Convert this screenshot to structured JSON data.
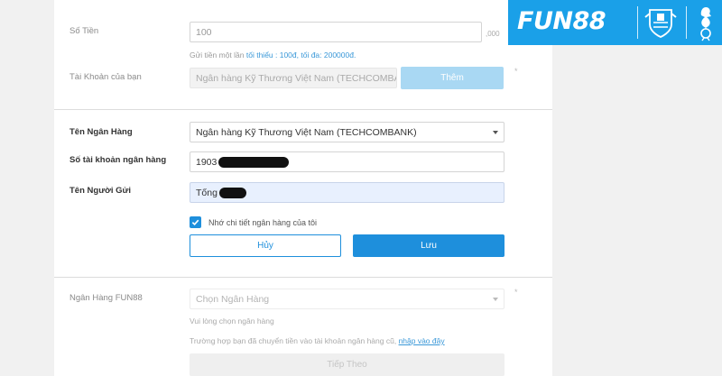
{
  "amount": {
    "label": "Số Tiền",
    "value": "100",
    "suffix": ",000",
    "hint_prefix": "Gửi tiền một lần",
    "hint_link": "tối thiểu : 100đ, tối đa: 200000đ."
  },
  "account": {
    "label": "Tài Khoản của bạn",
    "value": "Ngân hàng Kỹ Thương Việt Nam (TECHCOMBA",
    "add_label": "Thêm",
    "star": "*"
  },
  "bank_form": {
    "bank_name_label": "Tên Ngân Hàng",
    "bank_name_value": "Ngân hàng Kỹ Thương Việt Nam (TECHCOMBANK)",
    "account_no_label": "Số tài khoản ngân hàng",
    "account_no_value": "1903",
    "sender_label": "Tên Người Gửi",
    "sender_value": "Tống",
    "remember_label": "Nhớ chi tiết ngân hàng của tôi",
    "cancel_label": "Hủy",
    "save_label": "Lưu"
  },
  "fun88_bank": {
    "label": "Ngân Hàng FUN88",
    "placeholder": "Chọn Ngân Hàng",
    "star": "*",
    "error": "Vui lòng chọn ngân hàng",
    "note_text": "Trường hợp bạn đã chuyển tiền vào tài khoản ngân hàng cũ,",
    "note_link": "nhập vào đây",
    "next_label": "Tiếp Theo"
  },
  "brand": {
    "logo_text": "FUN88"
  },
  "colors": {
    "primary": "#1e8fdc",
    "link": "#3a98d8",
    "brand_bg": "#1aa0e8"
  }
}
